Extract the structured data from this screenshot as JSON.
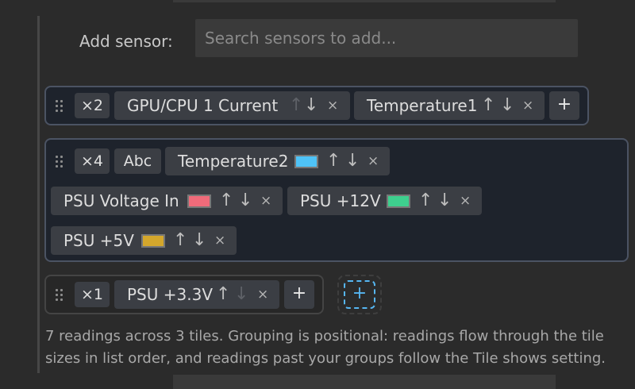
{
  "add_sensor": {
    "label": "Add sensor:",
    "placeholder": "Search sensors to add..."
  },
  "tiles": [
    {
      "size": "×2",
      "readings": [
        {
          "label": "GPU/CPU 1 Current",
          "up": "↑",
          "down": "↓",
          "remove": "×",
          "up_disabled": true
        },
        {
          "label": "Temperature1",
          "up": "↑",
          "down": "↓",
          "remove": "×"
        }
      ],
      "add": "+"
    },
    {
      "size": "×4",
      "format_badge": "Abc",
      "readings": [
        {
          "label": "Temperature2",
          "color": "#4fc3f7",
          "up": "↑",
          "down": "↓",
          "remove": "×"
        },
        {
          "label": "PSU Voltage In",
          "color": "#f06b7a",
          "up": "↑",
          "down": "↓",
          "remove": "×"
        },
        {
          "label": "PSU +12V",
          "color": "#3ecf8e",
          "up": "↑",
          "down": "↓",
          "remove": "×"
        },
        {
          "label": "PSU +5V",
          "color": "#d4a72c",
          "up": "↑",
          "down": "↓",
          "remove": "×"
        }
      ]
    },
    {
      "size": "×1",
      "readings": [
        {
          "label": "PSU +3.3V",
          "up": "↑",
          "down": "↓",
          "remove": "×",
          "down_disabled": true
        }
      ],
      "add": "+"
    }
  ],
  "new_tile": {
    "label": "+"
  },
  "footer": "7 readings across 3 tiles. Grouping is positional: readings flow through the tile sizes in list order, and readings past your groups follow the Tile shows setting."
}
